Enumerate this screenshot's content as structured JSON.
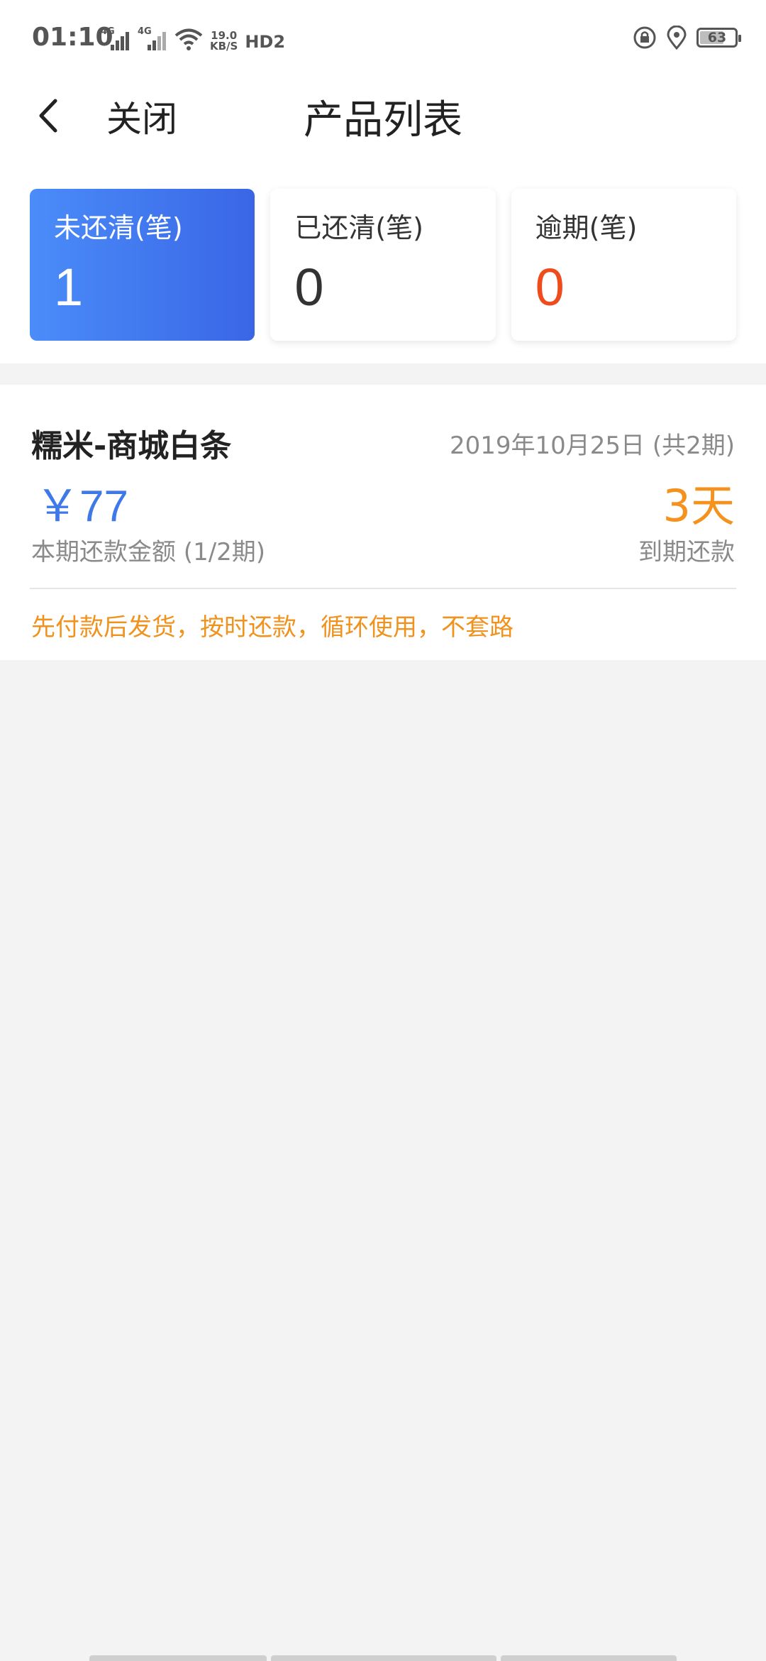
{
  "status_bar": {
    "time": "01:10",
    "network_1": "4G",
    "network_2": "4G",
    "speed_value": "19.0",
    "speed_unit": "KB/S",
    "hd": "HD2",
    "battery": "63"
  },
  "nav": {
    "close_label": "关闭",
    "title": "产品列表"
  },
  "stats": [
    {
      "label": "未还清(笔)",
      "value": "1"
    },
    {
      "label": "已还清(笔)",
      "value": "0"
    },
    {
      "label": "逾期(笔)",
      "value": "0"
    }
  ],
  "product": {
    "name": "糯米-商城白条",
    "date": "2019年10月25日 (共2期)",
    "amount": "￥77",
    "amount_label": "本期还款金额 (1/2期)",
    "days": "3天",
    "due_label": "到期还款",
    "slogan": "先付款后发货，按时还款，循环使用，不套路"
  },
  "colors": {
    "accent_blue": "#3f79e8",
    "overdue_red": "#ee4c1c",
    "orange": "#f5921e"
  }
}
